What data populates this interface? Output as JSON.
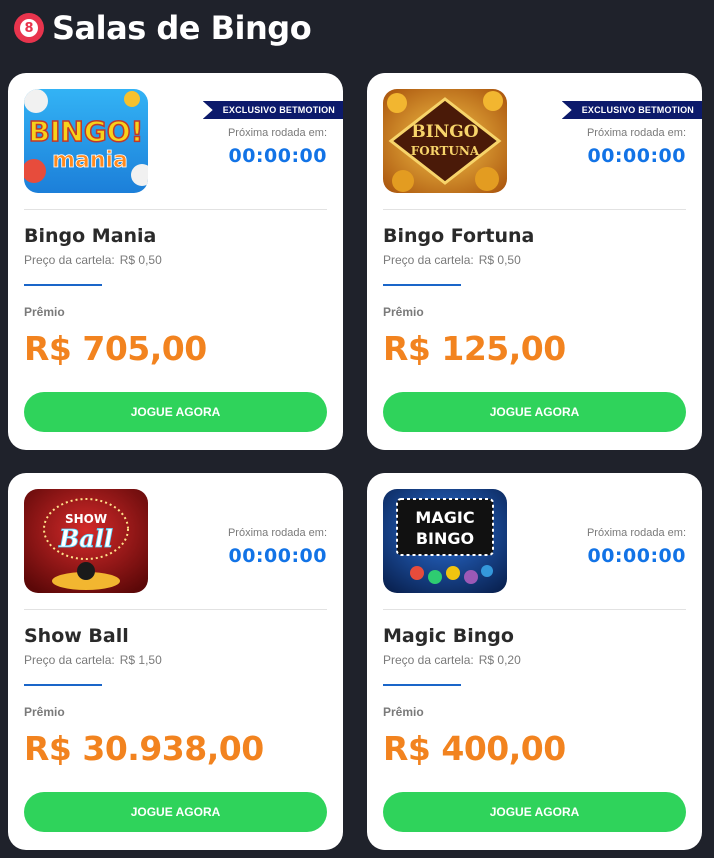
{
  "header": {
    "title": "Salas de Bingo",
    "icon_glyph": "8",
    "icon": "bingo-ball-icon"
  },
  "common": {
    "next_round_label": "Próxima rodada em:",
    "price_label": "Preço da cartela:",
    "prize_label": "Prêmio",
    "play_label": "JOGUE AGORA"
  },
  "rooms": [
    {
      "name": "Bingo Mania",
      "badge": "EXCLUSIVO BETMOTION",
      "timer": "00:00:00",
      "price": "R$ 0,50",
      "prize": "R$ 705,00",
      "thumb_text": [
        "BINGO!",
        "mania"
      ]
    },
    {
      "name": "Bingo Fortuna",
      "badge": "EXCLUSIVO BETMOTION",
      "timer": "00:00:00",
      "price": "R$ 0,50",
      "prize": "R$ 125,00",
      "thumb_text": [
        "BINGO",
        "FORTUNA"
      ]
    },
    {
      "name": "Show Ball",
      "badge": "",
      "timer": "00:00:00",
      "price": "R$ 1,50",
      "prize": "R$ 30.938,00",
      "thumb_text": [
        "SHOW",
        "Ball"
      ]
    },
    {
      "name": "Magic Bingo",
      "badge": "",
      "timer": "00:00:00",
      "price": "R$ 0,20",
      "prize": "R$ 400,00",
      "thumb_text": [
        "MAGIC",
        "BINGO"
      ]
    }
  ],
  "colors": {
    "background": "#1f222b",
    "timer": "#1273e6",
    "prize": "#f2831f",
    "button": "#2fd35b",
    "badge": "#0c1a6b"
  }
}
